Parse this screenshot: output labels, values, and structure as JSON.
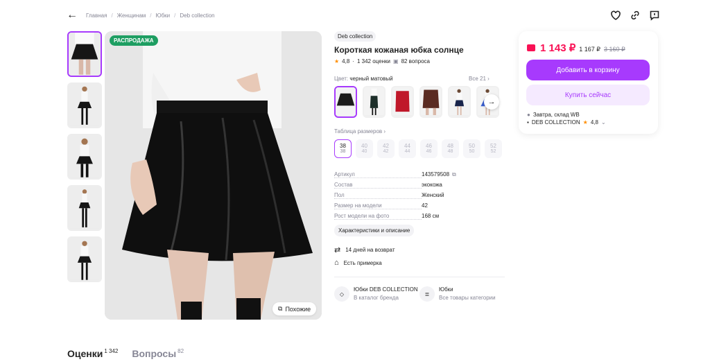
{
  "breadcrumbs": [
    "Главная",
    "Женщинам",
    "Юбки",
    "Deb collection"
  ],
  "badge": "РАСПРОДАЖА",
  "similar_label": "Похожие",
  "brand": "Deb collection",
  "title": "Короткая кожаная юбка солнце",
  "rating": "4,8",
  "reviews_count": "1 342 оценки",
  "questions_count": "82 вопроса",
  "color": {
    "label": "Цвет:",
    "value": "черный матовый",
    "all": "Все 21 ›"
  },
  "swatch_colors": [
    "#1c1c1c",
    "#1d2f2a",
    "#c0182a",
    "#5a2b22",
    "#18244a",
    "#3b5fd0"
  ],
  "size_table_label": "Таблица размеров ›",
  "sizes": [
    {
      "size": "38",
      "ru": "38",
      "selected": true
    },
    {
      "size": "40",
      "ru": "40"
    },
    {
      "size": "42",
      "ru": "42"
    },
    {
      "size": "44",
      "ru": "44"
    },
    {
      "size": "46",
      "ru": "46"
    },
    {
      "size": "48",
      "ru": "48"
    },
    {
      "size": "50",
      "ru": "50"
    },
    {
      "size": "52",
      "ru": "52"
    }
  ],
  "params": [
    {
      "key": "Артикул",
      "value": "143579508"
    },
    {
      "key": "Состав",
      "value": "экокожа"
    },
    {
      "key": "Пол",
      "value": "Женский"
    },
    {
      "key": "Размер на модели",
      "value": "42"
    },
    {
      "key": "Рост модели на фото",
      "value": "168 см"
    }
  ],
  "char_label": "Характеристики и описание",
  "features": [
    "14 дней на возврат",
    "Есть примерка"
  ],
  "links": [
    {
      "title": "Юбки DEB COLLECTION",
      "sub": "В каталог бренда"
    },
    {
      "title": "Юбки",
      "sub": "Все товары категории"
    }
  ],
  "price": {
    "main": "1 143 ₽",
    "wallet": "1 167 ₽",
    "old": "3 160 ₽"
  },
  "buttons": {
    "cart": "Добавить в корзину",
    "buy": "Купить сейчас"
  },
  "delivery": "Завтра, склад WB",
  "seller": "DEB COLLECTION",
  "seller_rating": "4,8",
  "tabs": [
    {
      "label": "Оценки",
      "count": "1 342"
    },
    {
      "label": "Вопросы",
      "count": "82"
    }
  ]
}
